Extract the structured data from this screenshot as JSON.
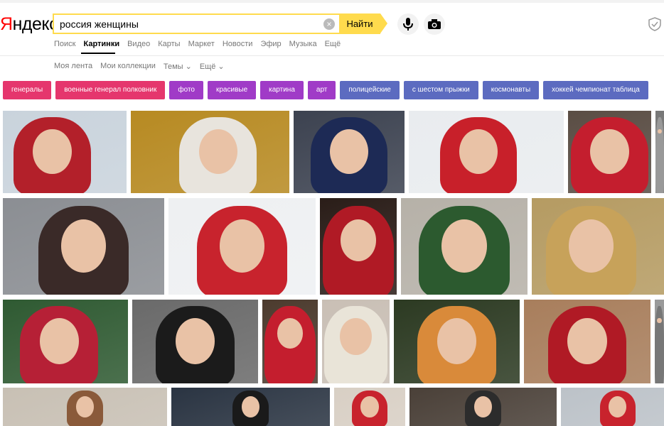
{
  "logo": {
    "first_letter": "Я",
    "rest": "ндекс"
  },
  "search": {
    "query": "россия женщины",
    "clear_symbol": "×",
    "button_label": "Найти"
  },
  "nav_tabs": [
    "Поиск",
    "Картинки",
    "Видео",
    "Карты",
    "Маркет",
    "Новости",
    "Эфир",
    "Музыка",
    "Ещё"
  ],
  "active_tab": "Картинки",
  "sub_nav": [
    "Моя лента",
    "Мои коллекции",
    "Темы ⌄",
    "Ещё ⌄"
  ],
  "tags": [
    {
      "label": "генералы",
      "color": "#e5366d"
    },
    {
      "label": "военные генерал полковник",
      "color": "#e5366d"
    },
    {
      "label": "фото",
      "color": "#a03bc7"
    },
    {
      "label": "красивые",
      "color": "#a03bc7"
    },
    {
      "label": "картина",
      "color": "#a03bc7"
    },
    {
      "label": "арт",
      "color": "#a03bc7"
    },
    {
      "label": "полицейские",
      "color": "#5c6bc0"
    },
    {
      "label": "с шестом прыжки",
      "color": "#5c6bc0"
    },
    {
      "label": "космонавты",
      "color": "#5c6bc0"
    },
    {
      "label": "хоккей чемпионат таблица",
      "color": "#5c6bc0"
    }
  ],
  "colors": {
    "brand_red": "#ff0000",
    "search_yellow": "#ffdb4d"
  },
  "icons": [
    "microphone-icon",
    "camera-icon",
    "shield-icon",
    "clear-icon"
  ]
}
